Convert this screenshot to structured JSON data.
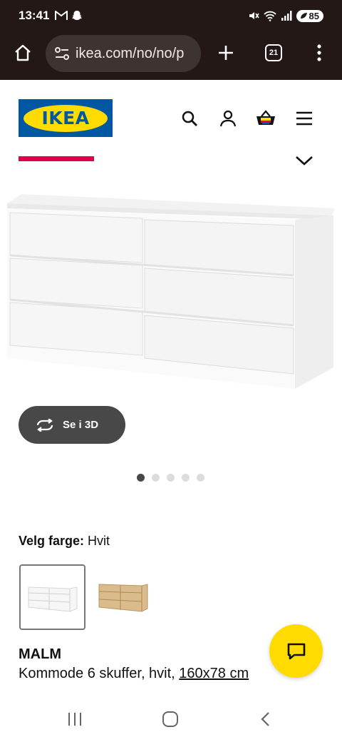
{
  "status_bar": {
    "time": "13:41",
    "battery": "85"
  },
  "browser": {
    "url": "ikea.com/no/no/p",
    "tab_count": "21"
  },
  "site": {
    "logo_text": "IKEA",
    "brand_blue": "#0058a3",
    "brand_yellow": "#ffdb00"
  },
  "gallery": {
    "view3d_label": "Se i 3D",
    "dot_count": 5,
    "active_dot": 0
  },
  "color_selector": {
    "label": "Velg farge:",
    "value": "Hvit",
    "swatches": [
      {
        "name": "Hvit",
        "selected": true
      },
      {
        "name": "hvitbeiset eikefiner",
        "selected": false
      }
    ]
  },
  "product": {
    "name": "MALM",
    "description_prefix": "Kommode 6 skuffer, hvit, ",
    "size": "160x78 cm"
  },
  "icons": {
    "home": "home-icon",
    "site_settings": "tune-icon",
    "new_tab": "plus-icon",
    "menu": "more-vert-icon",
    "search": "search-icon",
    "account": "user-icon",
    "basket": "basket-icon",
    "hamburger": "hamburger-icon",
    "chat": "chat-icon"
  }
}
